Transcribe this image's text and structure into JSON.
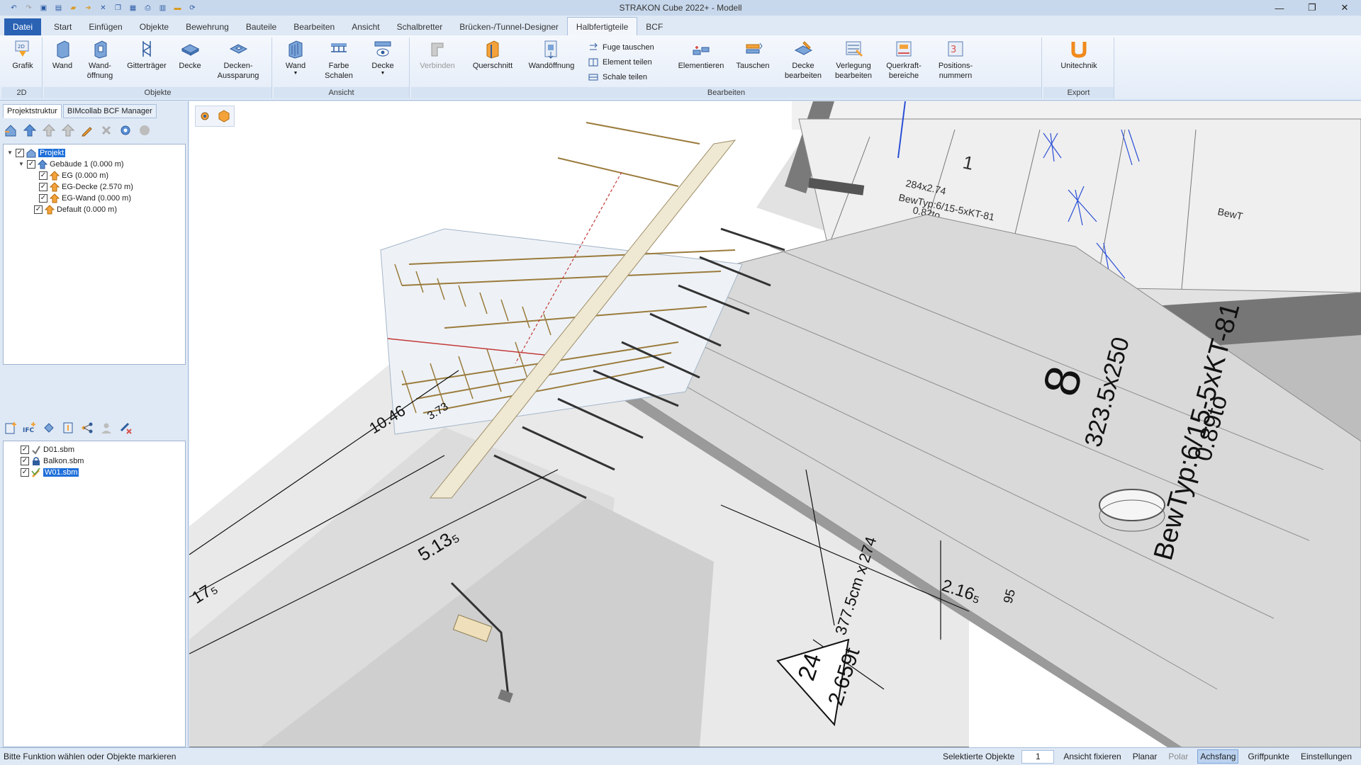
{
  "app": {
    "title": "STRAKON Cube 2022+ - Modell",
    "window_controls": [
      "—",
      "❐",
      "✕"
    ]
  },
  "ribbon_tabs": [
    "Datei",
    "Start",
    "Einfügen",
    "Objekte",
    "Bewehrung",
    "Bauteile",
    "Bearbeiten",
    "Ansicht",
    "Schalbretter",
    "Brücken-/Tunnel-Designer",
    "Halbfertigteile",
    "BCF"
  ],
  "active_tab": "Halbfertigteile",
  "ribbon": {
    "groups": {
      "g2d": "2D",
      "objekte": "Objekte",
      "ansicht": "Ansicht",
      "bearbeiten": "Bearbeiten",
      "export": "Export"
    },
    "buttons": {
      "grafik": "Grafik",
      "wand": "Wand",
      "wandoeffnung": "Wand-\nöffnung",
      "gittertraeger": "Gitterträger",
      "decke": "Decke",
      "deckenaussparung": "Decken-\nAussparung",
      "ansicht_wand": "Wand",
      "farbe_schalen": "Farbe\nSchalen",
      "ansicht_decke": "Decke",
      "verbinden": "Verbinden",
      "querschnitt": "Querschnitt",
      "wandoeffnung2": "Wandöffnung",
      "fuge_tauschen": "Fuge tauschen",
      "element_teilen": "Element teilen",
      "schale_teilen": "Schale teilen",
      "elementieren": "Elementieren",
      "tauschen": "Tauschen",
      "decke_bearbeiten": "Decke\nbearbeiten",
      "verlegung_bearbeiten": "Verlegung\nbearbeiten",
      "querkraftbereiche": "Querkraft-\nbereiche",
      "positionsnummern": "Positions-\nnummern",
      "unitechnik": "Unitechnik"
    }
  },
  "left_panel": {
    "tabs": [
      "Projektstruktur",
      "BIMcollab BCF Manager"
    ],
    "tree": [
      {
        "label": "Projekt",
        "level": 0,
        "selected": true
      },
      {
        "label": "Gebäude 1 (0.000 m)",
        "level": 1
      },
      {
        "label": "EG (0.000 m)",
        "level": 2
      },
      {
        "label": "EG-Decke (2.570 m)",
        "level": 2
      },
      {
        "label": "EG-Wand (0.000 m)",
        "level": 2
      },
      {
        "label": "Default (0.000 m)",
        "level": 1
      }
    ],
    "files": [
      {
        "label": "D01.sbm"
      },
      {
        "label": "Balkon.sbm"
      },
      {
        "label": "W01.sbm",
        "selected": true
      }
    ]
  },
  "viewport": {
    "annotations": {
      "dim_1046": "10.46",
      "dim_373": "3.73",
      "dim_5135": "5.13₅",
      "dim_175": "17₅",
      "dim_2165": "2.16₅",
      "dim_95": "95",
      "element_no": "8",
      "element_size": "323.5x250",
      "element_type": "BewTyp:6/15-5xKT-81",
      "element_weight": "0.89to",
      "slab_no": "1",
      "slab_text1": "284x2.74",
      "slab_text2": "BewTyp:6/15-5xKT-81",
      "slab_text3": "0.82to",
      "slab_text4": "BewT",
      "tri_no": "24",
      "tri_weight": "2.659t",
      "tri_size": "377.5cm x 274"
    }
  },
  "status": {
    "message": "Bitte Funktion wählen oder Objekte markieren",
    "selected_label": "Selektierte Objekte",
    "selected_count": "1",
    "items": [
      "Ansicht fixieren",
      "Planar",
      "Polar",
      "Achsfang",
      "Griffpunkte",
      "Einstellungen"
    ]
  }
}
